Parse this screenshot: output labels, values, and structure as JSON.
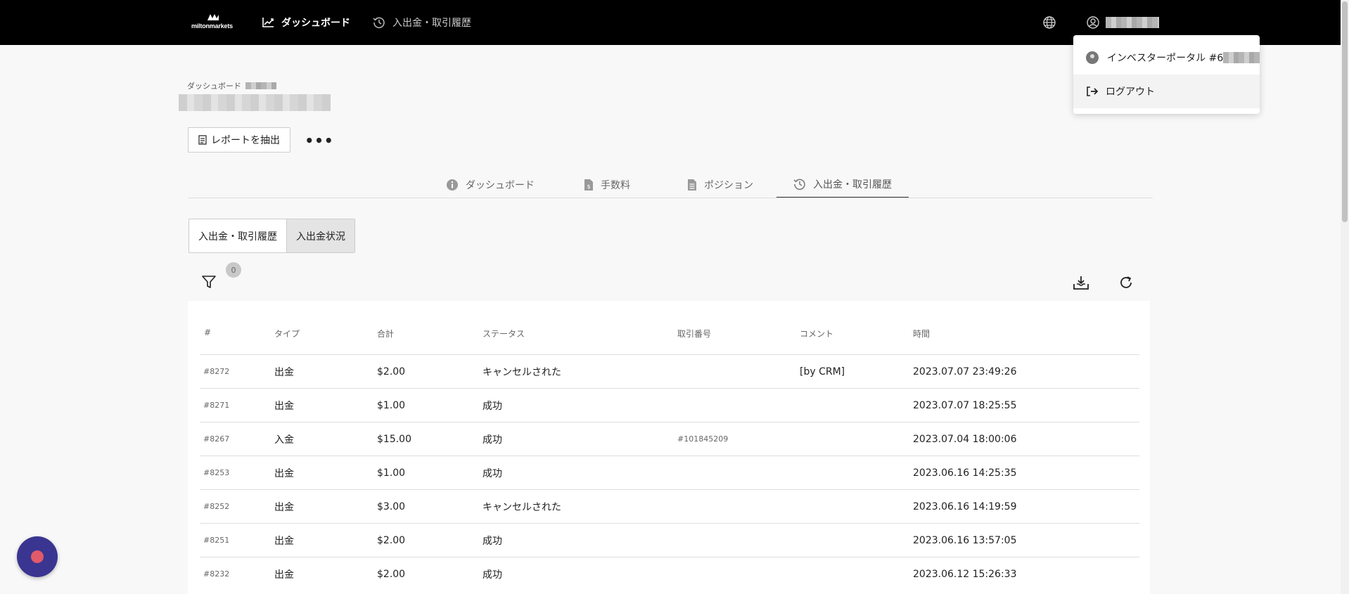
{
  "brand": {
    "logo_text": "miltonmarkets"
  },
  "nav": {
    "dashboard": "ダッシュボード",
    "history": "入出金・取引履歴"
  },
  "user_menu": {
    "portal": "インベスターポータル #6",
    "logout": "ログアウト"
  },
  "header": {
    "breadcrumb": "ダッシュボード",
    "report_button": "レポートを抽出",
    "more_button": "•••"
  },
  "tabs": [
    {
      "label": "ダッシュボード",
      "active": false
    },
    {
      "label": "手数料",
      "active": false
    },
    {
      "label": "ポジション",
      "active": false
    },
    {
      "label": "入出金・取引履歴",
      "active": true
    }
  ],
  "subtabs": [
    {
      "label": "入出金・取引履歴",
      "active": false
    },
    {
      "label": "入出金状況",
      "active": true
    }
  ],
  "filter": {
    "count": "0"
  },
  "table": {
    "headers": [
      "#",
      "タイプ",
      "合計",
      "ステータス",
      "取引番号",
      "コメント",
      "時間"
    ],
    "rows": [
      {
        "id": "#8272",
        "type": "出金",
        "total": "$2.00",
        "status": "キャンセルされた",
        "tx": "",
        "comment": "[by CRM]",
        "time": "2023.07.07 23:49:26"
      },
      {
        "id": "#8271",
        "type": "出金",
        "total": "$1.00",
        "status": "成功",
        "tx": "",
        "comment": "",
        "time": "2023.07.07 18:25:55"
      },
      {
        "id": "#8267",
        "type": "入金",
        "total": "$15.00",
        "status": "成功",
        "tx": "#101845209",
        "comment": "",
        "time": "2023.07.04 18:00:06"
      },
      {
        "id": "#8253",
        "type": "出金",
        "total": "$1.00",
        "status": "成功",
        "tx": "",
        "comment": "",
        "time": "2023.06.16 14:25:35"
      },
      {
        "id": "#8252",
        "type": "出金",
        "total": "$3.00",
        "status": "キャンセルされた",
        "tx": "",
        "comment": "",
        "time": "2023.06.16 14:19:59"
      },
      {
        "id": "#8251",
        "type": "出金",
        "total": "$2.00",
        "status": "成功",
        "tx": "",
        "comment": "",
        "time": "2023.06.16 13:57:05"
      },
      {
        "id": "#8232",
        "type": "出金",
        "total": "$2.00",
        "status": "成功",
        "tx": "",
        "comment": "",
        "time": "2023.06.12 15:26:33"
      }
    ]
  },
  "colors": {
    "topbar": "#000000",
    "chat_widget": "#3a3590",
    "chat_dot": "#e05a6a"
  }
}
